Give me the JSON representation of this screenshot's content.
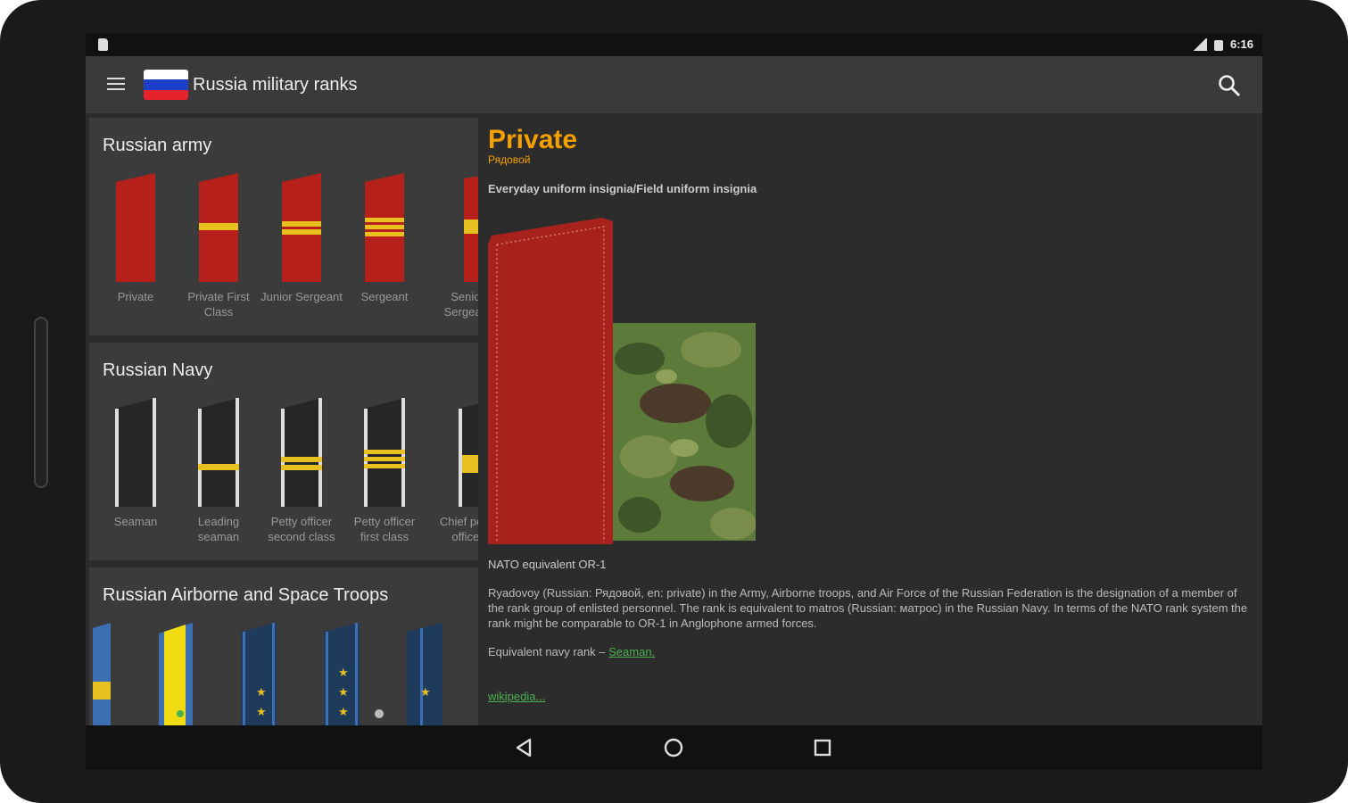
{
  "status": {
    "time": "6:16"
  },
  "appbar": {
    "title": "Russia military ranks",
    "flag_colors": [
      "#ffffff",
      "#1c3fc9",
      "#e5222b"
    ]
  },
  "sections": [
    {
      "title": "Russian army",
      "ranks": [
        {
          "label": "Private",
          "stripes": 0
        },
        {
          "label": "Private First Class",
          "stripes": 1
        },
        {
          "label": "Junior Sergeant",
          "stripes": 2
        },
        {
          "label": "Sergeant",
          "stripes": 3
        },
        {
          "label": "Senior Sergeant",
          "stripes": 1
        }
      ]
    },
    {
      "title": "Russian Navy",
      "ranks": [
        {
          "label": "Seaman",
          "stripes": 0
        },
        {
          "label": "Leading seaman",
          "stripes": 1
        },
        {
          "label": "Petty officer second class",
          "stripes": 2
        },
        {
          "label": "Petty officer first class",
          "stripes": 3
        },
        {
          "label": "Chief petty officer",
          "stripes": 1
        }
      ]
    },
    {
      "title": "Russian Airborne and Space Troops"
    }
  ],
  "detail": {
    "title": "Private",
    "subtitle": "Рядовой",
    "uniform_label": "Everyday uniform insignia/Field uniform insignia",
    "nato": "NATO equivalent OR-1",
    "description": "Ryadovoy (Russian: Рядовой, en: private) in the Army, Airborne troops, and Air Force of the Russian Federation is the designation of a member of the rank group of enlisted personnel. The rank is equivalent to matros (Russian: матрос) in the Russian Navy. In terms of the NATO rank system the rank might be comparable to OR-1 in Anglophone armed forces.",
    "equiv_prefix": "Equivalent navy rank – ",
    "equiv_link": "Seaman.",
    "wiki_link": "wikipedia..."
  },
  "colors": {
    "accent": "#f5a000",
    "army_red": "#b5201a",
    "stripe_gold": "#e8c020",
    "link_green": "#4caf50"
  }
}
